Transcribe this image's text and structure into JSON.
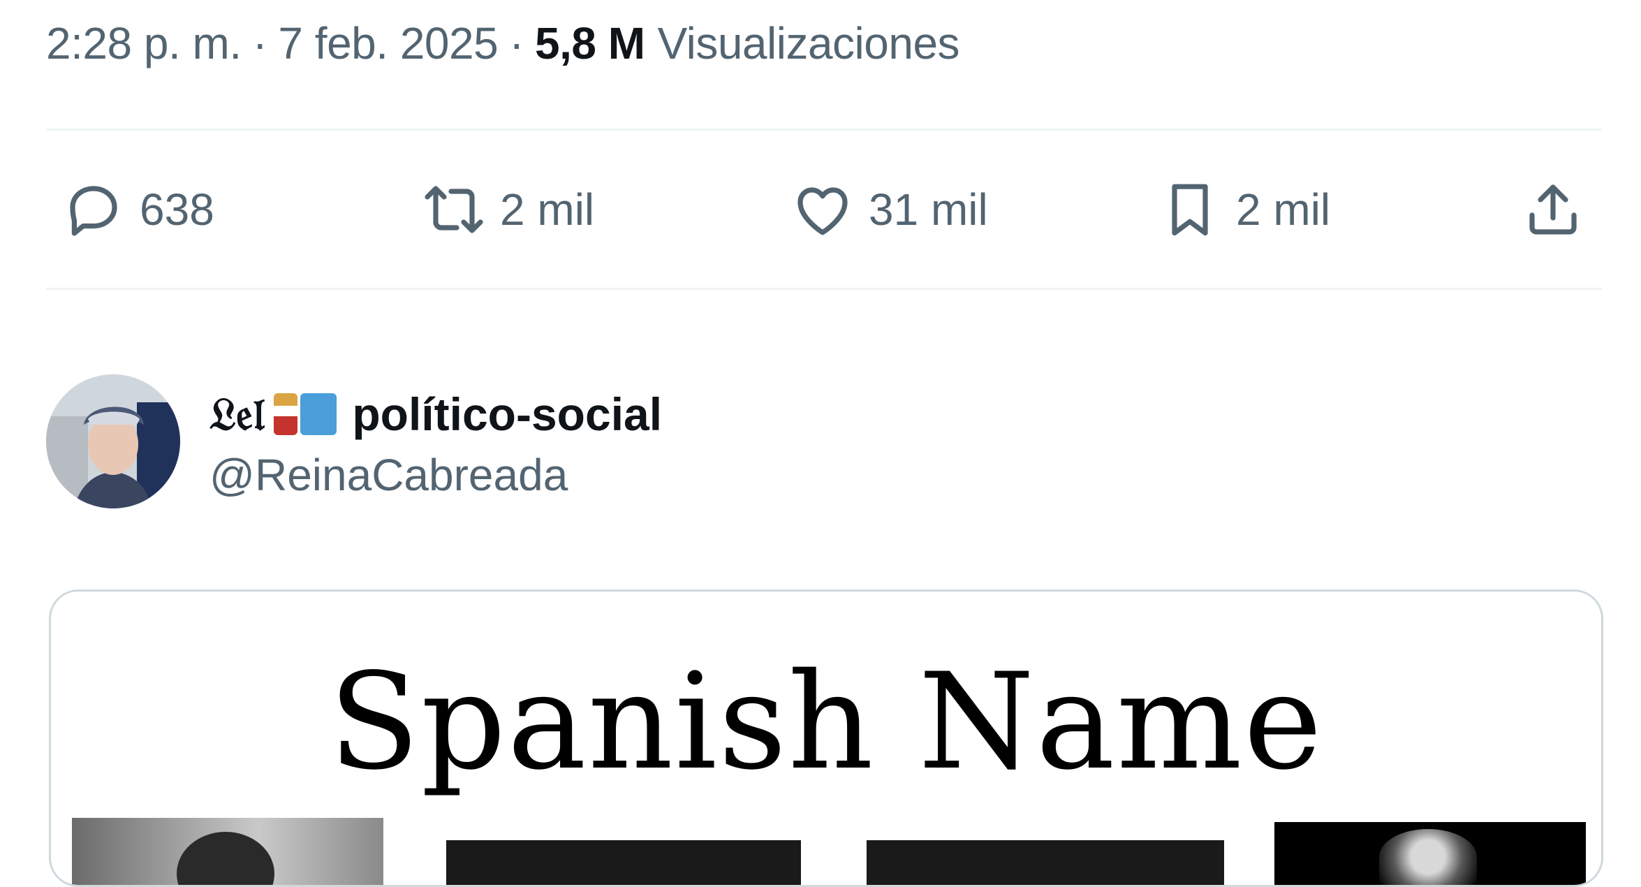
{
  "tweet_meta": {
    "time": "2:28 p. m.",
    "separator": "·",
    "date": "7 feb. 2025",
    "views_count": "5,8 M",
    "views_label": "Visualizaciones"
  },
  "actions": {
    "reply_count": "638",
    "repost_count": "2 mil",
    "like_count": "31 mil",
    "bookmark_count": "2 mil"
  },
  "icons": {
    "reply": "reply-icon",
    "repost": "repost-icon",
    "like": "heart-icon",
    "bookmark": "bookmark-icon",
    "share": "share-icon"
  },
  "author": {
    "name_prefix": "𝔏𝔢𝔩",
    "display_name": "político-social",
    "handle": "@ReinaCabreada"
  },
  "media": {
    "title": "Spanish Name"
  },
  "colors": {
    "text_primary": "#0f1419",
    "text_secondary": "#536471",
    "divider": "#eff3f4",
    "card_border": "#cfd9de"
  }
}
